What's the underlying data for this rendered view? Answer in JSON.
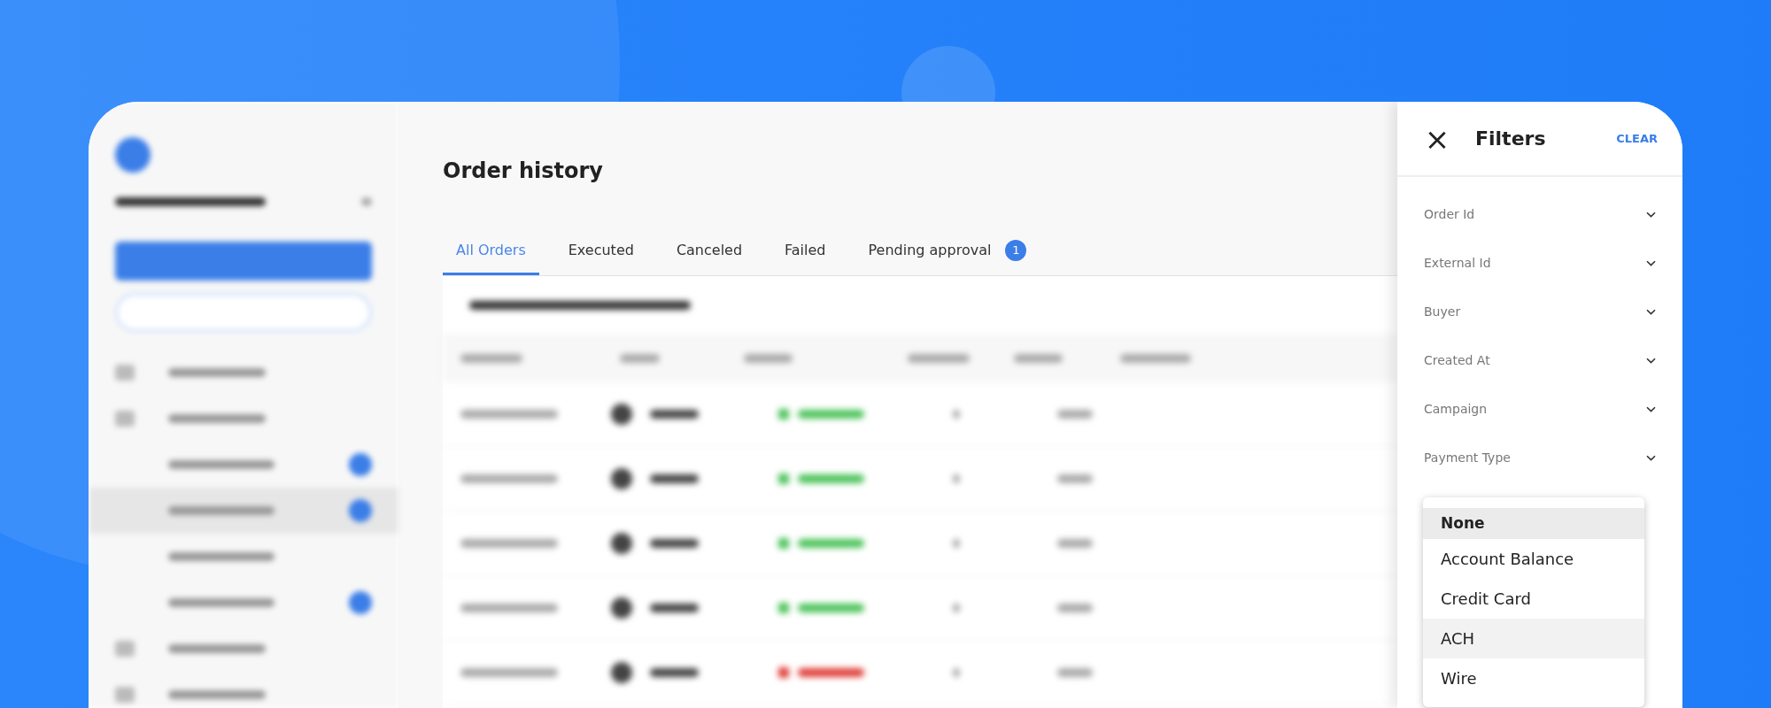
{
  "page": {
    "title": "Order history"
  },
  "tabs": [
    {
      "label": "All Orders",
      "selected": true
    },
    {
      "label": "Executed",
      "selected": false
    },
    {
      "label": "Canceled",
      "selected": false
    },
    {
      "label": "Failed",
      "selected": false
    },
    {
      "label": "Pending approval",
      "selected": false,
      "badge": "1"
    }
  ],
  "filters": {
    "title": "Filters",
    "close": "×",
    "clear": "CLEAR",
    "items": [
      {
        "label": "Order Id"
      },
      {
        "label": "External Id"
      },
      {
        "label": "Buyer"
      },
      {
        "label": "Created At"
      },
      {
        "label": "Campaign"
      },
      {
        "label": "Payment Type"
      }
    ],
    "dropdown": [
      {
        "label": "None",
        "selected": true,
        "highlighted": false
      },
      {
        "label": "Account Balance",
        "selected": false,
        "highlighted": false
      },
      {
        "label": "Credit Card",
        "selected": false,
        "highlighted": false
      },
      {
        "label": "ACH",
        "selected": false,
        "highlighted": true
      },
      {
        "label": "Wire",
        "selected": false,
        "highlighted": false
      }
    ]
  }
}
